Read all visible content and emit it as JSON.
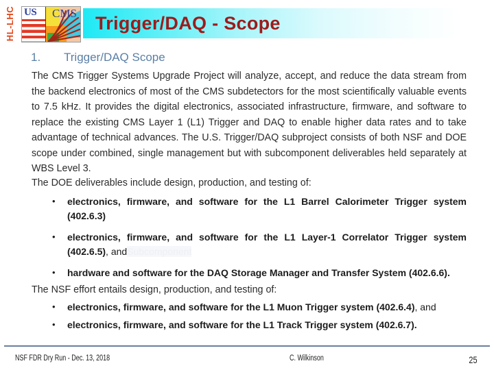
{
  "header": {
    "hl_lhc_label": "HL-LHC",
    "logo": {
      "us_text": "US",
      "cms_text": "CMS",
      "name": "us-cms-hl-lhc-logo"
    },
    "title": "Trigger/DAQ - Scope",
    "title_band_gradient_start": "#1ee9f5",
    "title_band_gradient_end": "#ffffff",
    "title_color": "#9d1b1b"
  },
  "body": {
    "section_number": "1.",
    "section_heading": "Trigger/DAQ Scope",
    "section_heading_color": "#5a7fa6",
    "paragraph_1": "The CMS Trigger Systems Upgrade Project will analyze, accept, and reduce the data stream from the backend electronics of most of the CMS subdetectors for the most scientifically valuable events to 7.5 kHz. It provides the digital electronics, associated infrastructure, firmware, and software to replace the existing CMS Layer 1 (L1) Trigger and DAQ to enable higher data rates and to take advantage of technical advances. The U.S. Trigger/DAQ subproject consists of both NSF and DOE scope under combined, single management but with subcomponent deliverables held separately at WBS Level 3.",
    "doe_intro": "The DOE deliverables include design, production, and testing of:",
    "doe_bullets": [
      {
        "bold": "electronics, firmware, and software for the L1 Barrel Calorimeter Trigger system (402.6.3)",
        "tail": ""
      },
      {
        "bold": "electronics, firmware, and software  for the L1 Layer-1 Correlator Trigger system (402.6.5)",
        "tail": ", and",
        "ghost": "Subcomponent"
      },
      {
        "bold": "hardware and software for the DAQ Storage Manager and Transfer System (402.6.6).",
        "tail": ""
      }
    ],
    "nsf_intro": "The NSF effort entails design, production, and testing of:",
    "nsf_bullets": [
      {
        "bold": "electronics, firmware, and software for the L1 Muon Trigger system (402.6.4)",
        "tail": ", and"
      },
      {
        "bold": "electronics, firmware, and software for the L1 Track Trigger system (402.6.7).",
        "tail": ""
      }
    ]
  },
  "footer": {
    "left": "NSF FDR Dry Run - Dec. 13, 2018",
    "center": "C. Wilkinson",
    "page_number": "25",
    "rule_color": "#6a7f9c"
  }
}
